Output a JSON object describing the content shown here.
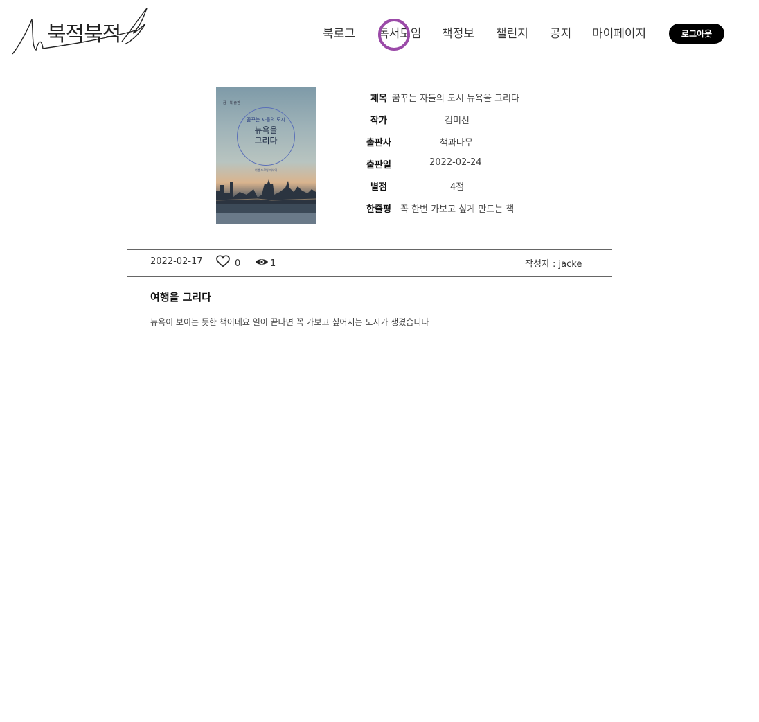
{
  "header": {
    "logo_text": "북적북적",
    "nav": [
      "북로그",
      "독서모임",
      "책정보",
      "챌린지",
      "공지",
      "마이페이지"
    ],
    "logout_label": "로그아웃"
  },
  "book": {
    "cover": {
      "top_text": "꿈 · 북 출판",
      "subtitle": "꿈꾸는 자들의 도시",
      "title": "뉴욕을\n그리다",
      "tagline": "— 여행 드로잉 에세이 —"
    },
    "fields": [
      {
        "label": "제목",
        "value": "꿈꾸는 자들의 도시 뉴욕을 그리다"
      },
      {
        "label": "작가",
        "value": "김미선"
      },
      {
        "label": "출판사",
        "value": "책과나무"
      },
      {
        "label": "출판일",
        "value": "2022-02-24"
      },
      {
        "label": "별점",
        "value": "4점"
      },
      {
        "label": "한줄평",
        "value": "꼭 한번 가보고 싶게 만드는 책"
      }
    ]
  },
  "post": {
    "date": "2022-02-17",
    "likes": "0",
    "views": "1",
    "author": "작성자 : jacke",
    "title": "여행을 그리다",
    "body": "뉴욕이 보이는 듯한 책이네요 일이 끝나면 꼭 가보고 싶어지는 도시가 생겼습니다"
  },
  "icons": {
    "like": "heart-icon",
    "views": "eye-icon"
  },
  "colors": {
    "cursor_ring": "#9b4aa8",
    "logout_bg": "#000000"
  }
}
